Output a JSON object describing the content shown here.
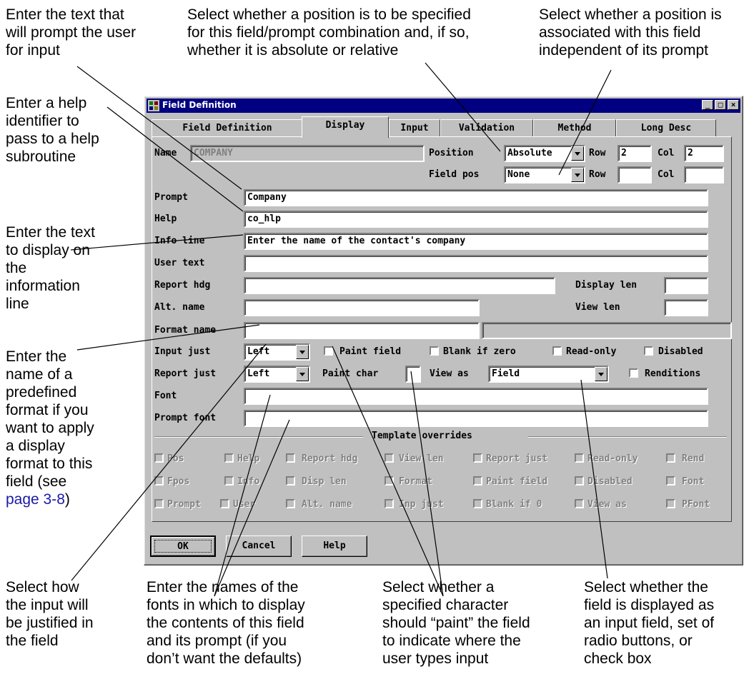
{
  "annotations": {
    "prompt_text": [
      "Enter the text that",
      "will prompt the user",
      "for input"
    ],
    "position_select": [
      "Select whether a position is to be specified",
      "for this field/prompt combination and, if so,",
      "whether it is absolute or relative"
    ],
    "field_pos_select": [
      "Select whether a position is",
      "associated with this field",
      "independent of its prompt"
    ],
    "help_identifier": [
      "Enter a help",
      "identifier to",
      "pass to a help",
      "subroutine"
    ],
    "info_line": [
      "Enter the text",
      "to display on",
      "the",
      "information",
      "line"
    ],
    "format_name": [
      "Enter the",
      "name of a",
      "predefined",
      "format if you",
      "want to apply",
      "a display",
      "format to this",
      "field (see"
    ],
    "format_link": "page 3-8",
    "format_close": ")",
    "input_just": [
      "Select how",
      "the input will",
      "be justified in",
      "the field"
    ],
    "fonts": [
      "Enter the names of the",
      "fonts in which to display",
      "the contents of this field",
      "and its prompt (if you",
      "don’t want the defaults)"
    ],
    "paint_char": [
      "Select whether a",
      "specified character",
      "should “paint” the field",
      "to indicate where the",
      "user types input"
    ],
    "view_as": [
      "Select whether the",
      "field is displayed as",
      "an input field, set of",
      "radio buttons, or",
      "check box"
    ]
  },
  "window": {
    "title": "Field Definition",
    "controls": [
      "_",
      "□",
      "×"
    ]
  },
  "tabs": [
    "Field Definition",
    "Display",
    "Input",
    "Validation",
    "Method",
    "Long Desc"
  ],
  "form": {
    "name_label": "Name",
    "name_value": "COMPANY",
    "position_label": "Position",
    "position_value": "Absolute",
    "row_label": "Row",
    "row_value": "2",
    "col_label": "Col",
    "col_value": "2",
    "field_pos_label": "Field pos",
    "field_pos_value": "None",
    "row2_label": "Row",
    "row2_value": "",
    "col2_label": "Col",
    "col2_value": "",
    "prompt_label": "Prompt",
    "prompt_value": "Company",
    "help_label": "Help",
    "help_value": "co_hlp",
    "info_line_label": "Info line",
    "info_line_value": "Enter the name of the contact's company",
    "user_text_label": "User text",
    "user_text_value": "",
    "report_hdg_label": "Report hdg",
    "report_hdg_value": "",
    "display_len_label": "Display len",
    "display_len_value": "",
    "alt_name_label": "Alt. name",
    "alt_name_value": "",
    "view_len_label": "View len",
    "view_len_value": "",
    "format_name_label": "Format name",
    "format_name_value": "",
    "input_just_label": "Input just",
    "input_just_value": "Left",
    "paint_field_label": "Paint field",
    "blank_if_zero_label": "Blank if zero",
    "read_only_label": "Read-only",
    "disabled_label": "Disabled",
    "report_just_label": "Report just",
    "report_just_value": "Left",
    "paint_char_label": "Paint char",
    "paint_char_value": "",
    "view_as_label": "View as",
    "view_as_value": "Field",
    "renditions_label": "Renditions",
    "font_label": "Font",
    "font_value": "",
    "prompt_font_label": "Prompt font",
    "prompt_font_value": ""
  },
  "overrides": {
    "title": "Template overrides",
    "rows": [
      [
        "Pos",
        "Help",
        "Report hdg",
        "View len",
        "Report just",
        "Read-only",
        "Rend"
      ],
      [
        "Fpos",
        "Info",
        "Disp len",
        "Format",
        "Paint field",
        "Disabled",
        "Font"
      ],
      [
        "Prompt",
        "User",
        "Alt. name",
        "Inp just",
        "Blank if 0",
        "View as",
        "PFont"
      ]
    ]
  },
  "buttons": {
    "ok": "OK",
    "cancel": "Cancel",
    "help": "Help"
  }
}
